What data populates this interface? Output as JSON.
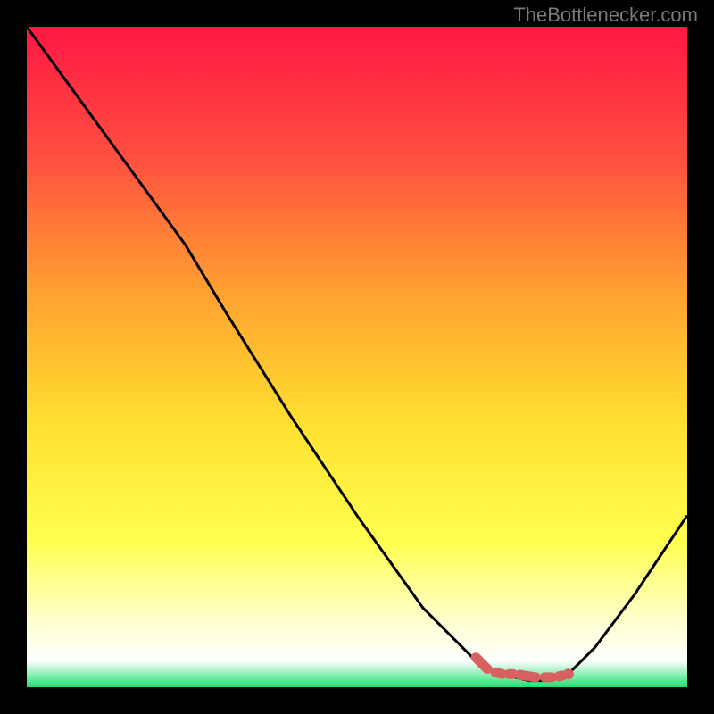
{
  "watermark": "TheBottlenecker.com",
  "chart_data": {
    "type": "line",
    "title": "",
    "xlabel": "",
    "ylabel": "",
    "xlim": [
      0,
      100
    ],
    "ylim": [
      0,
      100
    ],
    "grid": false,
    "series": [
      {
        "name": "bottleneck-curve",
        "color": "#000000",
        "x": [
          0,
          8,
          16,
          24,
          30,
          40,
          50,
          60,
          68,
          72,
          76,
          79,
          82,
          86,
          92,
          100
        ],
        "y": [
          100,
          89,
          78,
          67,
          57,
          41,
          26,
          12,
          4,
          2,
          1,
          1,
          2,
          6,
          14,
          26
        ]
      },
      {
        "name": "optimal-markers",
        "color": "#d86060",
        "type": "segment",
        "x": [
          68,
          70,
          72,
          74,
          77,
          80,
          82
        ],
        "y": [
          4.5,
          2.5,
          2,
          2,
          1.5,
          1.5,
          2
        ]
      }
    ],
    "background": {
      "type": "gradient",
      "stops": [
        {
          "offset": 0,
          "color": "#ff1744"
        },
        {
          "offset": 20,
          "color": "#ff5040"
        },
        {
          "offset": 40,
          "color": "#ffa030"
        },
        {
          "offset": 60,
          "color": "#ffe030"
        },
        {
          "offset": 78,
          "color": "#ffff50"
        },
        {
          "offset": 90,
          "color": "#ffffd0"
        },
        {
          "offset": 96,
          "color": "#ffffff"
        },
        {
          "offset": 100,
          "color": "#20e070"
        }
      ]
    }
  }
}
